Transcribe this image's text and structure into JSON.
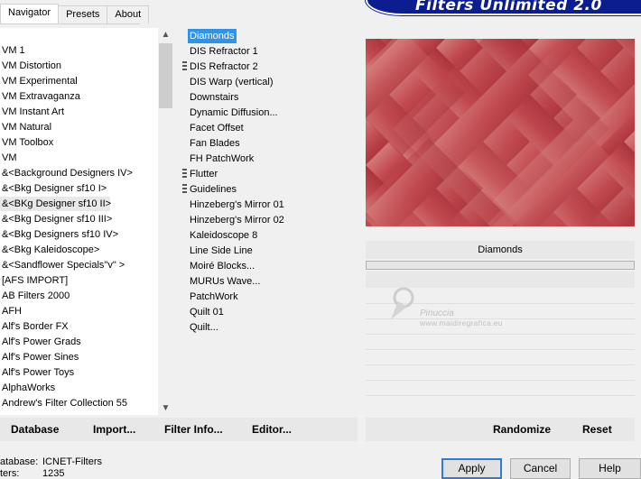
{
  "banner": {
    "title": "Filters Unlimited 2.0"
  },
  "tabs": [
    {
      "label": "Navigator",
      "active": true
    },
    {
      "label": "Presets",
      "active": false
    },
    {
      "label": "About",
      "active": false
    }
  ],
  "navigator": {
    "items": [
      "VM 1",
      "VM Distortion",
      "VM Experimental",
      "VM Extravaganza",
      "VM Instant Art",
      "VM Natural",
      "VM Toolbox",
      "VM",
      "&<Background Designers IV>",
      "&<Bkg Designer sf10 I>",
      "&<BKg Designer sf10 II>",
      "&<Bkg Designer sf10 III>",
      "&<Bkg Designers sf10 IV>",
      "&<Bkg Kaleidoscope>",
      "&<Sandflower Specials\"v\" >",
      "[AFS IMPORT]",
      "AB Filters 2000",
      "AFH",
      "Alf's Border FX",
      "Alf's Power Grads",
      "Alf's Power Sines",
      "Alf's Power Toys",
      "AlphaWorks",
      "Andrew's Filter Collection 55"
    ],
    "selected_index": 10
  },
  "filters": {
    "items": [
      "Diamonds",
      "DIS Refractor 1",
      "DIS Refractor 2",
      "DIS Warp (vertical)",
      "Downstairs",
      "Dynamic Diffusion...",
      "Facet Offset",
      "Fan Blades",
      "FH PatchWork",
      "Flutter",
      "Guidelines",
      "Hinzeberg's Mirror 01",
      "Hinzeberg's Mirror 02",
      "Kaleidoscope 8",
      "Line Side Line",
      "Moiré Blocks...",
      "MURUs Wave...",
      "PatchWork",
      "Quilt 01",
      "Quilt..."
    ],
    "selected_index": 0,
    "grip_indices": [
      2,
      9,
      10
    ]
  },
  "preview": {
    "effect_name": "Diamonds",
    "colors": {
      "dark": "#8e1b24",
      "mid": "#c0484f",
      "light": "#eab3a8"
    }
  },
  "watermark": {
    "name": "Pinuccia",
    "url": "www.maidiregrafica.eu"
  },
  "buttons_left": [
    {
      "key": "database",
      "label": "Database"
    },
    {
      "key": "import",
      "label": "Import..."
    },
    {
      "key": "filter_info",
      "label": "Filter Info..."
    },
    {
      "key": "editor",
      "label": "Editor..."
    }
  ],
  "buttons_right": {
    "randomize": "Randomize",
    "reset": "Reset"
  },
  "status": {
    "database_label": "atabase:",
    "database_value": "ICNET-Filters",
    "filters_label": "ters:",
    "filters_value": "1235"
  },
  "dialog": {
    "apply": "Apply",
    "cancel": "Cancel",
    "help": "Help"
  },
  "accent": "#2f93e8"
}
